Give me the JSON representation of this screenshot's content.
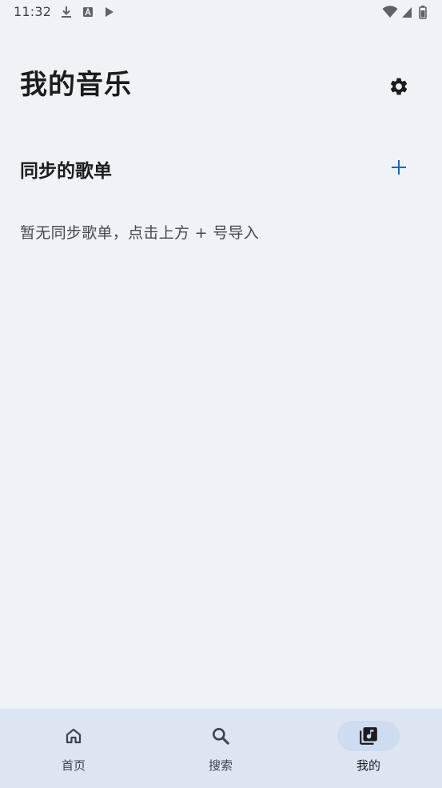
{
  "status_bar": {
    "time": "11:32",
    "left_icons": [
      "download-icon",
      "font-a-icon",
      "play-icon"
    ],
    "right_icons": [
      "wifi-icon",
      "signal-icon",
      "battery-icon"
    ]
  },
  "header": {
    "title": "我的音乐",
    "settings_icon": "gear-icon"
  },
  "section": {
    "title": "同步的歌单",
    "add_icon": "plus-icon",
    "empty_message": "暂无同步歌单，点击上方 + 号导入"
  },
  "bottom_nav": {
    "items": [
      {
        "label": "首页",
        "icon": "home-icon",
        "active": false
      },
      {
        "label": "搜索",
        "icon": "search-icon",
        "active": false
      },
      {
        "label": "我的",
        "icon": "music-library-icon",
        "active": true
      }
    ]
  },
  "colors": {
    "background": "#eff3f8",
    "nav_background": "#dde5f2",
    "nav_active_pill": "#cfdcef",
    "accent": "#1f63c9",
    "text_primary": "#1b1c1f",
    "text_secondary": "#45474c"
  }
}
